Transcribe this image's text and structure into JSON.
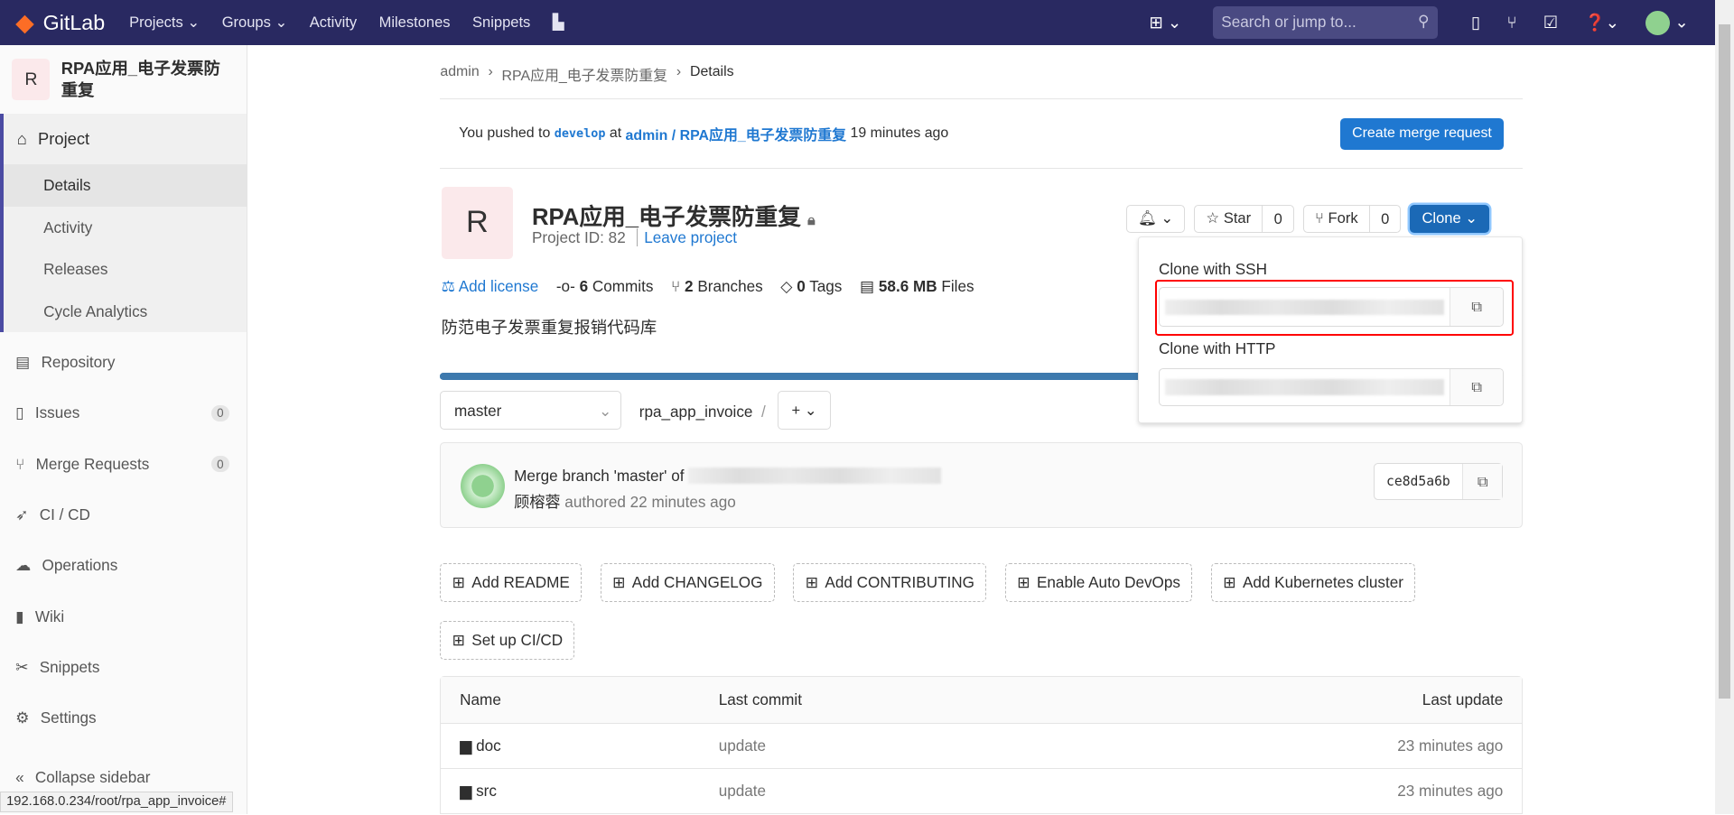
{
  "nav": {
    "brand": "GitLab",
    "links": [
      "Projects",
      "Groups",
      "Activity",
      "Milestones",
      "Snippets"
    ],
    "search_placeholder": "Search or jump to..."
  },
  "sidebar": {
    "project_initial": "R",
    "project_name": "RPA应用_电子发票防重复",
    "section": "Project",
    "sub": [
      "Details",
      "Activity",
      "Releases",
      "Cycle Analytics"
    ],
    "items": [
      {
        "label": "Repository"
      },
      {
        "label": "Issues",
        "count": "0"
      },
      {
        "label": "Merge Requests",
        "count": "0"
      },
      {
        "label": "CI / CD"
      },
      {
        "label": "Operations"
      },
      {
        "label": "Wiki"
      },
      {
        "label": "Snippets"
      },
      {
        "label": "Settings"
      }
    ],
    "collapse": "Collapse sidebar"
  },
  "breadcrumb": [
    "admin",
    "RPA应用_电子发票防重复",
    "Details"
  ],
  "push": {
    "prefix": "You pushed to",
    "branch": "develop",
    "at": "at",
    "project": "admin / RPA应用_电子发票防重复",
    "time": "19 minutes ago",
    "button": "Create merge request"
  },
  "project": {
    "initial": "R",
    "name": "RPA应用_电子发票防重复",
    "id": "Project ID: 82",
    "leave": "Leave project",
    "description": "防范电子发票重复报销代码库"
  },
  "stats": {
    "license": "Add license",
    "commits_n": "6",
    "commits": "Commits",
    "branches_n": "2",
    "branches": "Branches",
    "tags_n": "0",
    "tags": "Tags",
    "size": "58.6 MB",
    "files": "Files"
  },
  "actions": {
    "star": "Star",
    "star_count": "0",
    "fork": "Fork",
    "fork_count": "0",
    "clone": "Clone"
  },
  "clone": {
    "ssh_label": "Clone with SSH",
    "http_label": "Clone with HTTP"
  },
  "repo": {
    "branch": "master",
    "path": "rpa_app_invoice",
    "sep": "/",
    "plus": "+"
  },
  "commit": {
    "title": "Merge branch 'master' of",
    "author": "顾榕蓉",
    "authored": "authored 22 minutes ago",
    "sha": "ce8d5a6b"
  },
  "quick": [
    "Add README",
    "Add CHANGELOG",
    "Add CONTRIBUTING",
    "Enable Auto DevOps",
    "Add Kubernetes cluster",
    "Set up CI/CD"
  ],
  "table": {
    "headers": [
      "Name",
      "Last commit",
      "Last update"
    ],
    "rows": [
      {
        "name": "doc",
        "commit": "update",
        "time": "23 minutes ago"
      },
      {
        "name": "src",
        "commit": "update",
        "time": "23 minutes ago"
      }
    ]
  },
  "statusbar": "192.168.0.234/root/rpa_app_invoice#",
  "colors": {
    "nav": "#292961",
    "primary": "#1f78d1",
    "highlight": "#ff0000"
  }
}
